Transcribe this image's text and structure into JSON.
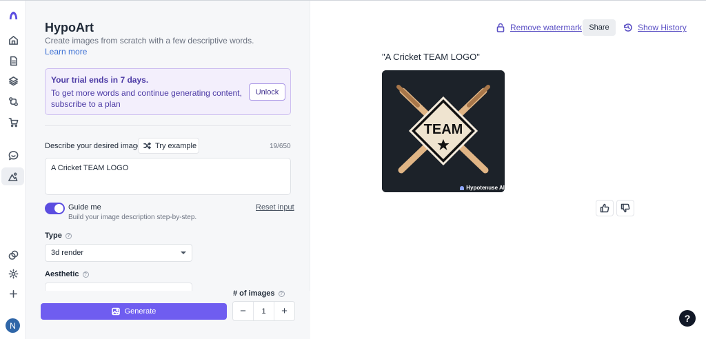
{
  "app": {
    "title": "HypoArt",
    "subtitle": "Create images from scratch with a few descriptive words.",
    "learn_more": "Learn more"
  },
  "sidebar": {
    "items": [
      {
        "icon": "logo-icon"
      },
      {
        "icon": "home-icon"
      },
      {
        "icon": "document-icon"
      },
      {
        "icon": "layers-icon"
      },
      {
        "icon": "workflow-icon"
      },
      {
        "icon": "cart-icon"
      },
      {
        "icon": "chat-icon"
      },
      {
        "icon": "image-art-icon",
        "active": true
      },
      {
        "icon": "integrations-icon"
      },
      {
        "icon": "settings-icon"
      },
      {
        "icon": "plus-icon"
      }
    ],
    "avatar_initial": "N"
  },
  "trial": {
    "title": "Your trial ends in 7 days.",
    "body": "To get more words and continue generating content, subscribe to a plan",
    "unlock": "Unlock"
  },
  "form": {
    "description_label": "Describe your desired image",
    "try_example": "Try example",
    "counter": "19/650",
    "description_value": "A Cricket TEAM LOGO",
    "guide_title": "Guide me",
    "guide_subtitle": "Build your image description step-by-step.",
    "guide_enabled": true,
    "reset_input": "Reset input",
    "type_label": "Type",
    "type_value": "3d render",
    "aesthetic_label": "Aesthetic",
    "num_images_label": "# of images",
    "num_images_value": "1",
    "generate": "Generate",
    "minus": "−",
    "plus": "+"
  },
  "toolbar": {
    "remove_watermark": "Remove watermark",
    "share": "Share",
    "show_history": "Show History"
  },
  "result": {
    "prompt_title": "\"A Cricket TEAM LOGO\"",
    "image_text": "TEAM",
    "watermark": "Hypotenuse AI"
  },
  "help_fab": "?",
  "colors": {
    "accent": "#6f5df0",
    "link": "#5a4fc4",
    "trial_border": "#cdbff0"
  }
}
